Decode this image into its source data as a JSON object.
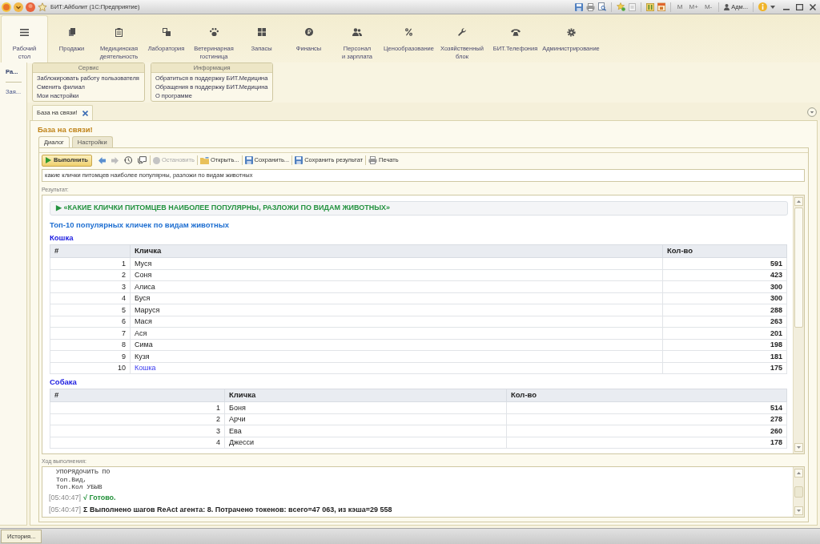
{
  "window": {
    "title": "БИТ:Айболит (1С:Предприятие)",
    "memory_buttons": [
      {
        "label": "M",
        "disabled": true
      },
      {
        "label": "M+",
        "disabled": true
      },
      {
        "label": "M-",
        "disabled": true
      }
    ],
    "user": "Адм..."
  },
  "sections": [
    {
      "label": "Рабочий стол",
      "selected": true
    },
    {
      "label": "Продажи",
      "selected": false
    },
    {
      "label": "Медицинская деятельность",
      "selected": false
    },
    {
      "label": "Лаборатория",
      "selected": false
    },
    {
      "label": "Ветеринарная гостиница",
      "selected": false
    },
    {
      "label": "Запасы",
      "selected": false
    },
    {
      "label": "Финансы",
      "selected": false
    },
    {
      "label": "Персонал и зарплата",
      "selected": false
    },
    {
      "label": "Ценообразование",
      "selected": false
    },
    {
      "label": "Хозяйственный блок",
      "selected": false
    },
    {
      "label": "БИТ.Телефония",
      "selected": false
    },
    {
      "label": "Администрирование",
      "selected": false
    }
  ],
  "sidebar": {
    "items": [
      {
        "label": "Ра...",
        "selected": true
      },
      {
        "label": "Зая...",
        "selected": false
      }
    ]
  },
  "function_groups": [
    {
      "title": "Сервис",
      "items": [
        "Заблокировать работу пользователя",
        "Сменить филиал",
        "Мои настройки"
      ]
    },
    {
      "title": "Информация",
      "items": [
        "Обратиться в поддержку БИТ.Медицина",
        "Обращения в поддержку БИТ.Медицина",
        "О программе"
      ]
    }
  ],
  "open_tabs": [
    {
      "label": "База на связи!",
      "selected": true
    }
  ],
  "form": {
    "title": "База на связи!",
    "tabs": [
      {
        "label": "Диалог",
        "selected": true
      },
      {
        "label": "Настройки",
        "selected": false
      }
    ],
    "toolbar": [
      {
        "kind": "primary",
        "label": "Выполнить",
        "disabled": false
      },
      {
        "kind": "icon",
        "disabled": false
      },
      {
        "kind": "icon",
        "disabled": true
      },
      {
        "kind": "icon",
        "disabled": false
      },
      {
        "kind": "icon",
        "disabled": false
      },
      {
        "kind": "text",
        "label": "Остановить",
        "disabled": true
      },
      {
        "kind": "text",
        "label": "Открыть...",
        "disabled": false
      },
      {
        "kind": "text",
        "label": "Сохранить...",
        "disabled": false
      },
      {
        "kind": "text",
        "label": "Сохранить результат",
        "disabled": false
      },
      {
        "kind": "text",
        "label": "Печать",
        "disabled": false
      }
    ],
    "query": {
      "value": "какие клички питомцев наиболее популярны, разложи по видам животных"
    },
    "result": {
      "label": "Результат:",
      "heading": "▶ «КАКИЕ КЛИЧКИ ПИТОМЦЕВ НАИБОЛЕЕ ПОПУЛЯРНЫ, РАЗЛОЖИ ПО ВИДАМ ЖИВОТНЫХ»",
      "title": "Топ-10 популярных кличек по видам животных",
      "groups": [
        {
          "name": "Кошка",
          "columns": [
            "#",
            "Кличка",
            "Кол-во"
          ],
          "rows": [
            {
              "cells": [
                "1",
                "Муся",
                "591"
              ],
              "link": false
            },
            {
              "cells": [
                "2",
                "Соня",
                "423"
              ],
              "link": false
            },
            {
              "cells": [
                "3",
                "Алиса",
                "300"
              ],
              "link": false
            },
            {
              "cells": [
                "4",
                "Буся",
                "300"
              ],
              "link": false
            },
            {
              "cells": [
                "5",
                "Маруся",
                "288"
              ],
              "link": false
            },
            {
              "cells": [
                "6",
                "Мася",
                "263"
              ],
              "link": false
            },
            {
              "cells": [
                "7",
                "Ася",
                "201"
              ],
              "link": false
            },
            {
              "cells": [
                "8",
                "Сима",
                "198"
              ],
              "link": false
            },
            {
              "cells": [
                "9",
                "Кузя",
                "181"
              ],
              "link": false
            },
            {
              "cells": [
                "10",
                "Кошка",
                "175"
              ],
              "link": true
            }
          ]
        },
        {
          "name": "Собака",
          "columns": [
            "#",
            "Кличка",
            "Кол-во"
          ],
          "rows": [
            {
              "cells": [
                "1",
                "Боня",
                "514"
              ],
              "link": false
            },
            {
              "cells": [
                "2",
                "Арчи",
                "278"
              ],
              "link": false
            },
            {
              "cells": [
                "3",
                "Ева",
                "260"
              ],
              "link": false
            },
            {
              "cells": [
                "4",
                "Джесси",
                "178"
              ],
              "link": false
            }
          ]
        }
      ]
    },
    "log": {
      "label": "Ход выполнения:",
      "lines": [
        {
          "kind": "code",
          "text": "УПОРЯДОЧИТЬ ПО"
        },
        {
          "kind": "code",
          "text": "Топ.Вид,"
        },
        {
          "kind": "code",
          "text": "Топ.Кол УБЫВ"
        },
        {
          "kind": "status",
          "time": "[05:40:47]",
          "text": "√ Готово."
        },
        {
          "kind": "summary",
          "time": "[05:40:47]",
          "text": "Σ Выполнено шагов ReAct агента: 8. Потрачено токенов: всего=47 063, из кэша=29 558"
        }
      ]
    }
  },
  "taskbar": {
    "items": [
      {
        "label": "История..."
      }
    ]
  }
}
